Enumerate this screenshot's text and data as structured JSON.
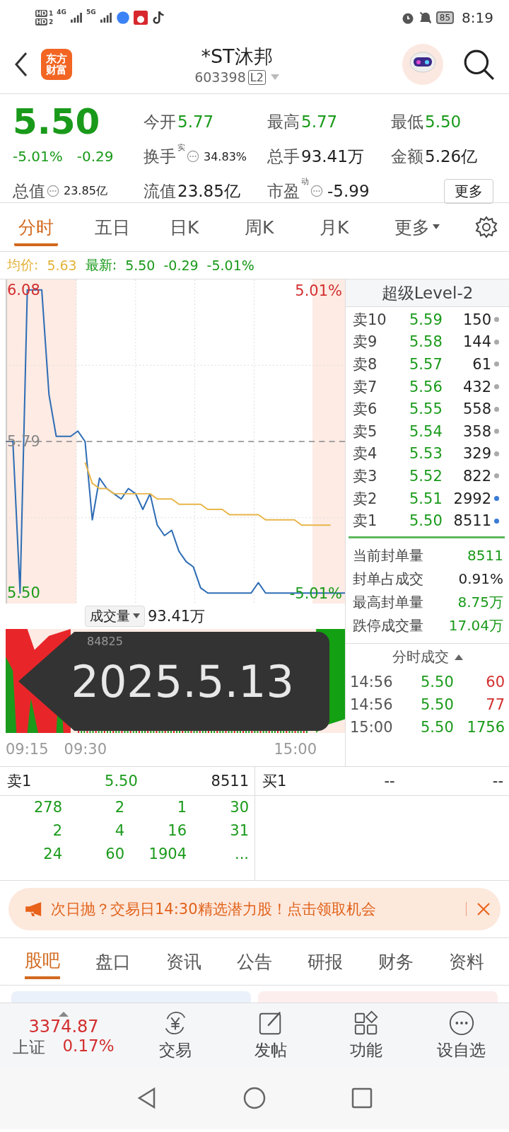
{
  "status_bar": {
    "sims": [
      {
        "label": "HD",
        "slot": "1"
      },
      {
        "label": "HD",
        "slot": "2"
      }
    ],
    "networks": [
      "4G",
      "5G"
    ],
    "battery": "85",
    "time": "8:19"
  },
  "header": {
    "logo": [
      "东方",
      "财富"
    ],
    "title": "*ST沐邦",
    "code": "603398",
    "badge": "L2"
  },
  "quote": {
    "price": "5.50",
    "change_pct": "-5.01%",
    "change": "-0.29",
    "stats": [
      {
        "label": "今开",
        "value": "5.77",
        "falling": true,
        "info": false
      },
      {
        "label": "最高",
        "value": "5.77",
        "falling": true,
        "info": false
      },
      {
        "label": "最低",
        "value": "5.50",
        "falling": true,
        "info": false
      },
      {
        "label": "换手",
        "sup": "实",
        "value": "34.83%",
        "falling": false,
        "info": true,
        "small": true
      },
      {
        "label": "总手",
        "value": "93.41万",
        "falling": false,
        "info": false
      },
      {
        "label": "金额",
        "value": "5.26亿",
        "falling": false,
        "info": false
      },
      {
        "label": "总值",
        "value": "23.85亿",
        "falling": false,
        "info": true,
        "small": true
      },
      {
        "label": "流值",
        "value": "23.85亿",
        "falling": false,
        "info": false
      },
      {
        "label": "市盈",
        "sup": "动",
        "value": "-5.99",
        "falling": false,
        "info": true
      }
    ],
    "more_button": "更多"
  },
  "chart_tabs": [
    {
      "label": "分时",
      "selected": true
    },
    {
      "label": "五日",
      "selected": false
    },
    {
      "label": "日K",
      "selected": false
    },
    {
      "label": "周K",
      "selected": false
    },
    {
      "label": "月K",
      "selected": false
    },
    {
      "label": "更多",
      "selected": false,
      "kind": "dropdown"
    }
  ],
  "price_line": {
    "avg_label": "均价:",
    "avg_value": "5.63",
    "last_label": "最新:",
    "last_value": "5.50",
    "change": "-0.29",
    "change_pct": "-5.01%"
  },
  "chart": {
    "chart_data": {
      "type": "line",
      "ylim": [
        5.48,
        6.1
      ],
      "yticks": [
        {
          "value": 5.5,
          "label": "5.50"
        },
        {
          "value": 5.79,
          "label": "5.79"
        },
        {
          "value": 6.08,
          "label": "6.08"
        }
      ],
      "series": [
        {
          "color": "#2f6db5",
          "values": [
            5.79,
            5.79,
            5.5,
            6.08,
            6.08,
            6.08,
            5.88,
            5.8,
            5.8,
            5.8,
            5.81,
            5.79,
            5.64,
            5.72,
            5.7,
            5.69,
            5.68,
            5.7,
            5.69,
            5.66,
            5.69,
            5.63,
            5.61,
            5.62,
            5.58,
            5.56,
            5.55,
            5.51,
            5.5,
            5.5,
            5.5,
            5.5,
            5.5,
            5.5,
            5.5,
            5.52,
            5.5,
            5.5,
            5.5,
            5.5,
            5.5,
            5.5,
            5.5,
            5.5,
            5.5,
            5.5,
            5.5,
            5.5
          ]
        },
        {
          "color": "#e8b64a",
          "values": [
            null,
            null,
            null,
            null,
            null,
            null,
            null,
            null,
            null,
            null,
            null,
            5.75,
            5.71,
            5.7,
            5.7,
            5.69,
            5.69,
            5.69,
            5.69,
            5.69,
            5.69,
            5.68,
            5.68,
            5.68,
            5.67,
            5.67,
            5.67,
            5.67,
            5.66,
            5.66,
            5.66,
            5.65,
            5.65,
            5.65,
            5.65,
            5.65,
            5.64,
            5.64,
            5.64,
            5.64,
            5.64,
            5.63,
            5.63,
            5.63,
            5.63,
            5.63,
            null,
            null
          ]
        },
        {
          "color": "#888888",
          "line_style": "dashed",
          "values": [
            5.79,
            5.79,
            5.79,
            5.79,
            5.79,
            5.79,
            5.79,
            5.79,
            5.79,
            5.79,
            5.79,
            5.79,
            5.79,
            5.79,
            5.79,
            5.79,
            5.79,
            5.79,
            5.79,
            5.79,
            5.79,
            5.79,
            5.79,
            5.79,
            5.79,
            5.79,
            5.79,
            5.79,
            5.79,
            5.79,
            5.79,
            5.79,
            5.79,
            5.79,
            5.79,
            5.79,
            5.79,
            5.79,
            5.79,
            5.79,
            5.79,
            5.79,
            5.79,
            5.79,
            5.79,
            5.79,
            5.79,
            5.79
          ]
        }
      ]
    },
    "high_pct": "5.01%",
    "low_pct": "-5.01%",
    "volume_selector": "成交量",
    "volume_total": "93.41万",
    "volume_peak": "84825",
    "times": [
      "09:15",
      "09:30",
      "15:00"
    ],
    "overlay_date": "2025.5.13"
  },
  "level2": {
    "title": "超级Level-2",
    "asks": [
      {
        "label": "卖10",
        "price": "5.59",
        "volume": "150",
        "highlighted": false
      },
      {
        "label": "卖9",
        "price": "5.58",
        "volume": "144",
        "highlighted": false
      },
      {
        "label": "卖8",
        "price": "5.57",
        "volume": "61",
        "highlighted": false
      },
      {
        "label": "卖7",
        "price": "5.56",
        "volume": "432",
        "highlighted": false
      },
      {
        "label": "卖6",
        "price": "5.55",
        "volume": "558",
        "highlighted": false
      },
      {
        "label": "卖5",
        "price": "5.54",
        "volume": "358",
        "highlighted": false
      },
      {
        "label": "卖4",
        "price": "5.53",
        "volume": "329",
        "highlighted": false
      },
      {
        "label": "卖3",
        "price": "5.52",
        "volume": "822",
        "highlighted": false
      },
      {
        "label": "卖2",
        "price": "5.51",
        "volume": "2992",
        "highlighted": true
      },
      {
        "label": "卖1",
        "price": "5.50",
        "volume": "8511",
        "highlighted": true
      }
    ],
    "seal_stats": [
      {
        "label": "当前封单量",
        "value": "8511",
        "falling": true
      },
      {
        "label": "封单占成交",
        "value": "0.91%",
        "falling": false
      },
      {
        "label": "最高封单量",
        "value": "8.75万",
        "falling": true
      },
      {
        "label": "跌停成交量",
        "value": "17.04万",
        "falling": true
      }
    ],
    "ticks_title": "分时成交",
    "ticks": [
      {
        "time": "14:56",
        "price": "5.50",
        "volume": "60",
        "buy": true
      },
      {
        "time": "14:56",
        "price": "5.50",
        "volume": "77",
        "buy": true
      },
      {
        "time": "15:00",
        "price": "5.50",
        "volume": "1756",
        "buy": false
      }
    ]
  },
  "order_queue": {
    "ask": {
      "label": "卖1",
      "price": "5.50",
      "volume": "8511"
    },
    "bid": {
      "label": "买1",
      "price": "--",
      "volume": "--"
    },
    "queue": [
      "278",
      "2",
      "1",
      "30",
      "2",
      "4",
      "16",
      "31",
      "24",
      "60",
      "1904",
      "..."
    ]
  },
  "banner": {
    "text": "次日抛？交易日14:30精选潜力股！点击领取机会"
  },
  "section_tabs": [
    {
      "label": "股吧",
      "selected": true
    },
    {
      "label": "盘口",
      "selected": false
    },
    {
      "label": "资讯",
      "selected": false
    },
    {
      "label": "公告",
      "selected": false
    },
    {
      "label": "研报",
      "selected": false
    },
    {
      "label": "财务",
      "selected": false
    },
    {
      "label": "资料",
      "selected": false
    }
  ],
  "bottom_nav": {
    "index": {
      "value": "3374.87",
      "name": "上证",
      "change": "0.17%"
    },
    "items": [
      {
        "label": "交易",
        "kind": "trade"
      },
      {
        "label": "发帖",
        "kind": "post"
      },
      {
        "label": "功能",
        "kind": "apps"
      },
      {
        "label": "设自选",
        "kind": "more"
      }
    ]
  }
}
